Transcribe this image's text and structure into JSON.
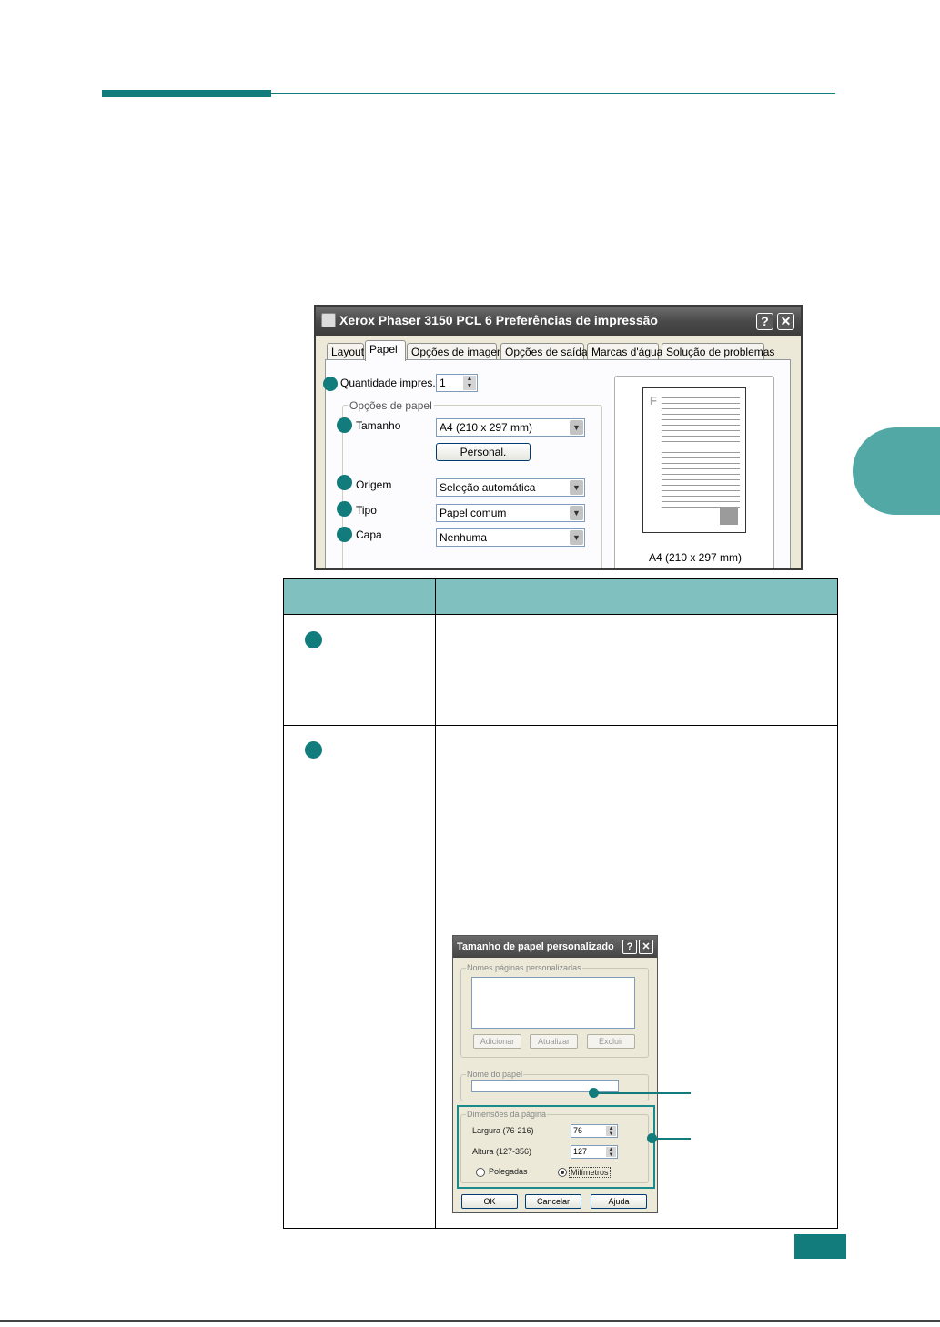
{
  "page": {
    "accent_color": "#127b7b",
    "side_tab_color": "#52a8a4",
    "table_header_color": "#80c1bf"
  },
  "main_dialog": {
    "title": "Xerox Phaser 3150 PCL 6 Preferências de impressão",
    "help_button": "?",
    "close_button": "✕",
    "tabs": [
      "Layout",
      "Papel",
      "Opções de imagem",
      "Opções de saída",
      "Marcas d'água",
      "Solução de problemas"
    ],
    "active_tab": "Papel",
    "quantity": {
      "label": "Quantidade impres.",
      "value": "1"
    },
    "paper_options": {
      "group_title": "Opções de papel",
      "size": {
        "label": "Tamanho",
        "value": "A4 (210 x 297 mm)"
      },
      "custom_button": "Personal.",
      "source": {
        "label": "Origem",
        "value": "Seleção automática"
      },
      "type": {
        "label": "Tipo",
        "value": "Papel comum"
      },
      "cover": {
        "label": "Capa",
        "value": "Nenhuma"
      }
    },
    "preview_caption": "A4 (210 x 297 mm)",
    "preview_letter": "F"
  },
  "custom_dialog": {
    "title": "Tamanho de papel personalizado",
    "help_button": "?",
    "close_button": "✕",
    "names_group": "Nomes páginas personalizadas",
    "add_button": "Adicionar",
    "update_button": "Atualizar",
    "delete_button": "Excluir",
    "paper_name_group": "Nome do papel",
    "dimensions_group": "Dimensões da página",
    "width": {
      "label": "Largura (76-216)",
      "value": "76"
    },
    "height": {
      "label": "Altura (127-356)",
      "value": "127"
    },
    "unit_inches": "Polegadas",
    "unit_mm": "Milímetros",
    "selected_unit": "Milímetros",
    "ok_button": "OK",
    "cancel_button": "Cancelar",
    "help_text_button": "Ajuda"
  }
}
